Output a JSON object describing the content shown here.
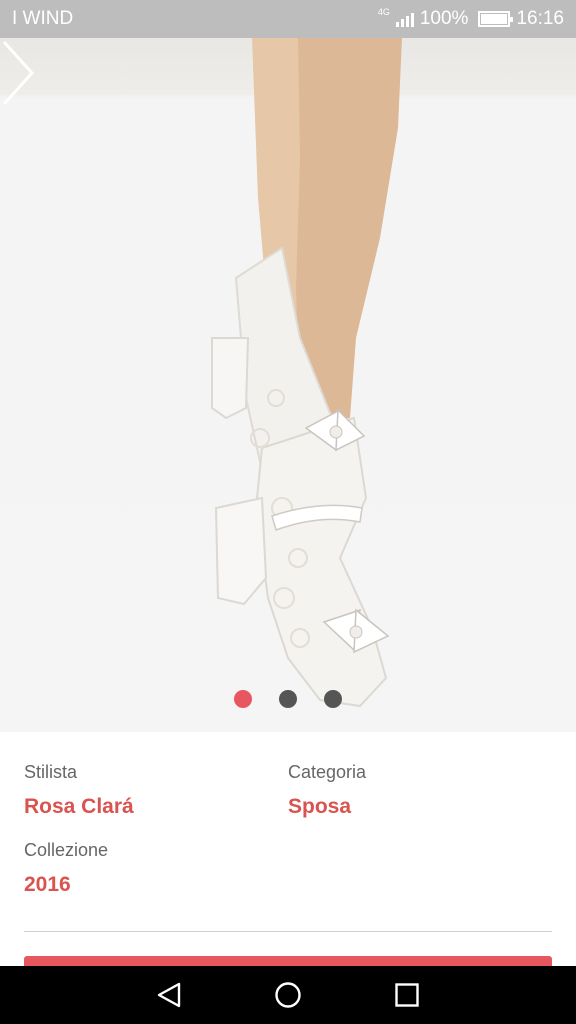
{
  "status_bar": {
    "carrier": "I WIND",
    "network": "4G",
    "battery": "100%",
    "time": "16:16"
  },
  "hero": {
    "image_description_icon": "shoe-photo",
    "next_icon": "chevron-right-icon",
    "pages_total": 3,
    "page_current": 1
  },
  "details": {
    "stylist_label": "Stilista",
    "stylist_value": "Rosa Clará",
    "category_label": "Categoria",
    "category_value": "Sposa",
    "collection_label": "Collezione",
    "collection_value": "2016"
  },
  "colors": {
    "accent": "#e8575f",
    "value_text": "#d9534f",
    "status_bar_bg": "#bdbdbd",
    "nav_bar_bg": "#000000"
  },
  "nav_bar": {
    "back_icon": "back-triangle-icon",
    "home_icon": "home-circle-icon",
    "recents_icon": "recents-square-icon"
  }
}
